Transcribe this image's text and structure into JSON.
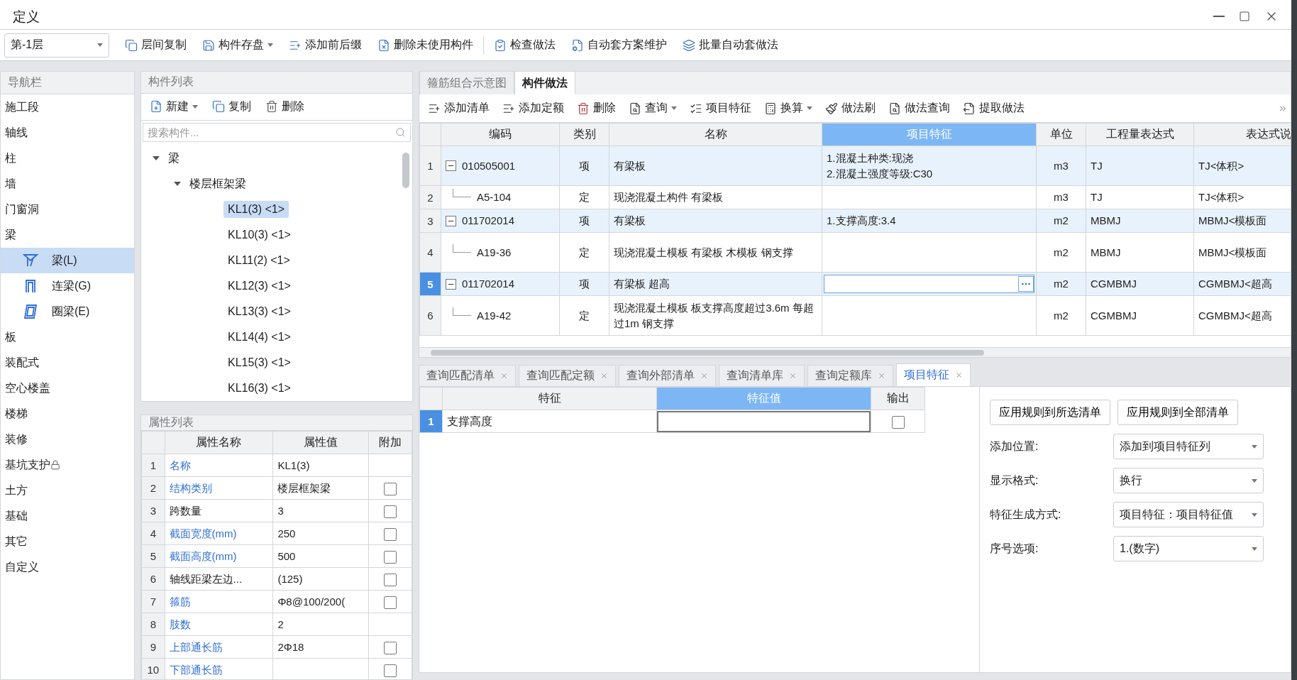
{
  "window": {
    "title": "定义"
  },
  "toolbar": {
    "floor": "第-1层",
    "buttons": [
      {
        "label": "层间复制",
        "dropdown": false
      },
      {
        "label": "构件存盘",
        "dropdown": true
      },
      {
        "label": "添加前后缀",
        "dropdown": false
      },
      {
        "label": "删除未使用构件",
        "dropdown": false
      },
      {
        "label": "检查做法",
        "dropdown": false
      },
      {
        "label": "自动套方案维护",
        "dropdown": false
      },
      {
        "label": "批量自动套做法",
        "dropdown": false
      }
    ]
  },
  "nav": {
    "title": "导航栏",
    "items": [
      {
        "label": "施工段",
        "selected": false
      },
      {
        "label": "轴线",
        "selected": false
      },
      {
        "label": "柱",
        "selected": false
      },
      {
        "label": "墙",
        "selected": false
      },
      {
        "label": "门窗洞",
        "selected": false
      },
      {
        "label": "梁",
        "selected": false,
        "children": [
          {
            "label": "梁(L)",
            "selected": true
          },
          {
            "label": "连梁(G)",
            "selected": false
          },
          {
            "label": "圈梁(E)",
            "selected": false
          }
        ]
      },
      {
        "label": "板",
        "selected": false
      },
      {
        "label": "装配式",
        "selected": false
      },
      {
        "label": "空心楼盖",
        "selected": false
      },
      {
        "label": "楼梯",
        "selected": false
      },
      {
        "label": "装修",
        "selected": false
      },
      {
        "label": "基坑支护",
        "selected": false,
        "locked": true
      },
      {
        "label": "土方",
        "selected": false
      },
      {
        "label": "基础",
        "selected": false
      },
      {
        "label": "其它",
        "selected": false
      },
      {
        "label": "自定义",
        "selected": false
      }
    ]
  },
  "component_list": {
    "title": "构件列表",
    "buttons": [
      {
        "label": "新建",
        "dropdown": true
      },
      {
        "label": "复制",
        "dropdown": false
      },
      {
        "label": "删除",
        "dropdown": false
      }
    ],
    "search": {
      "placeholder": "搜索构件..."
    },
    "tree": [
      {
        "label": "梁",
        "expanded": true,
        "children": [
          {
            "label": "楼层框架梁",
            "expanded": true,
            "children": [
              {
                "label": "KL1(3) <1>",
                "selected": true
              },
              {
                "label": "KL10(3) <1>",
                "selected": false
              },
              {
                "label": "KL11(2) <1>",
                "selected": false
              },
              {
                "label": "KL12(3) <1>",
                "selected": false
              },
              {
                "label": "KL13(3) <1>",
                "selected": false
              },
              {
                "label": "KL14(4) <1>",
                "selected": false
              },
              {
                "label": "KL15(3) <1>",
                "selected": false
              },
              {
                "label": "KL16(3) <1>",
                "selected": false
              }
            ]
          }
        ]
      }
    ]
  },
  "properties": {
    "title": "属性列表",
    "columns": [
      "属性名称",
      "属性值",
      "附加"
    ],
    "rows": [
      {
        "no": "1",
        "name": "名称",
        "value": "KL1(3)",
        "link": true,
        "kind": "plain"
      },
      {
        "no": "2",
        "name": "结构类别",
        "value": "楼层框架梁",
        "link": true,
        "kind": "checkbox",
        "checked": false
      },
      {
        "no": "3",
        "name": "跨数量",
        "value": "3",
        "link": false,
        "kind": "checkbox",
        "checked": false
      },
      {
        "no": "4",
        "name": "截面宽度(mm)",
        "value": "250",
        "link": true,
        "kind": "checkbox",
        "checked": false
      },
      {
        "no": "5",
        "name": "截面高度(mm)",
        "value": "500",
        "link": true,
        "kind": "checkbox",
        "checked": false
      },
      {
        "no": "6",
        "name": "轴线距梁左边...",
        "value": "(125)",
        "link": false,
        "kind": "checkbox",
        "checked": false
      },
      {
        "no": "7",
        "name": "箍筋",
        "value": "Φ8@100/200(",
        "link": true,
        "kind": "checkbox",
        "checked": false
      },
      {
        "no": "8",
        "name": "肢数",
        "value": "2",
        "link": true,
        "kind": "plain"
      },
      {
        "no": "9",
        "name": "上部通长筋",
        "value": "2Φ18",
        "link": true,
        "kind": "checkbox",
        "checked": false
      },
      {
        "no": "10",
        "name": "下部通长筋",
        "link": true,
        "kind": "checkbox",
        "checked": false
      }
    ]
  },
  "method_tabs": [
    {
      "label": "箍筋组合示意图",
      "selected": false
    },
    {
      "label": "构件做法",
      "selected": true
    }
  ],
  "method_toolbar": [
    {
      "label": "添加清单",
      "dropdown": false
    },
    {
      "label": "添加定额",
      "dropdown": false
    },
    {
      "label": "删除",
      "dropdown": false
    },
    {
      "label": "查询",
      "dropdown": true
    },
    {
      "label": "项目特征",
      "dropdown": false
    },
    {
      "label": "换算",
      "dropdown": true
    },
    {
      "label": "做法刷",
      "dropdown": false
    },
    {
      "label": "做法查询",
      "dropdown": false
    },
    {
      "label": "提取做法",
      "dropdown": false
    }
  ],
  "methods_table": {
    "columns": [
      {
        "label": "编码",
        "selected": false
      },
      {
        "label": "类别",
        "selected": false
      },
      {
        "label": "名称",
        "selected": false
      },
      {
        "label": "项目特征",
        "selected": true
      },
      {
        "label": "单位",
        "selected": false
      },
      {
        "label": "工程量表达式",
        "selected": false
      },
      {
        "label": "表达式说",
        "selected": false
      }
    ],
    "rows": [
      {
        "no": "1",
        "kind": "item",
        "selected": false,
        "editing": false,
        "code": "010505001",
        "category": "项",
        "name": "有梁板",
        "feature": [
          "1.混凝土种类:现浇",
          "2.混凝土强度等级:C30"
        ],
        "unit": "m3",
        "expr": "TJ",
        "expr_desc": "TJ<体积>"
      },
      {
        "no": "2",
        "kind": "quota",
        "selected": false,
        "editing": false,
        "code": "A5-104",
        "category": "定",
        "name": "现浇混凝土构件 有梁板",
        "feature": [],
        "unit": "m3",
        "expr": "TJ",
        "expr_desc": "TJ<体积>"
      },
      {
        "no": "3",
        "kind": "item",
        "selected": false,
        "editing": false,
        "code": "011702014",
        "category": "项",
        "name": "有梁板",
        "feature": [
          "1.支撑高度:3.4"
        ],
        "unit": "m2",
        "expr": "MBMJ",
        "expr_desc": "MBMJ<模板面"
      },
      {
        "no": "4",
        "kind": "quota",
        "selected": false,
        "editing": false,
        "code": "A19-36",
        "category": "定",
        "name": "现浇混凝土模板 有梁板 木模板 钢支撑",
        "feature": [],
        "unit": "m2",
        "expr": "MBMJ",
        "expr_desc": "MBMJ<模板面"
      },
      {
        "no": "5",
        "kind": "item",
        "selected": true,
        "editing": true,
        "code": "011702014",
        "category": "项",
        "name": "有梁板 超高",
        "feature": [],
        "unit": "m2",
        "expr": "CGMBMJ",
        "expr_desc": "CGMBMJ<超高"
      },
      {
        "no": "6",
        "kind": "quota",
        "selected": false,
        "editing": false,
        "code": "A19-42",
        "category": "定",
        "name": "现浇混凝土模板 板支撑高度超过3.6m 每超过1m 钢支撑",
        "feature": [],
        "unit": "m2",
        "expr": "CGMBMJ",
        "expr_desc": "CGMBMJ<超高"
      }
    ]
  },
  "bottom_tabs": [
    {
      "label": "查询匹配清单",
      "selected": false
    },
    {
      "label": "查询匹配定额",
      "selected": false
    },
    {
      "label": "查询外部清单",
      "selected": false
    },
    {
      "label": "查询清单库",
      "selected": false
    },
    {
      "label": "查询定额库",
      "selected": false
    },
    {
      "label": "项目特征",
      "selected": true
    }
  ],
  "feature_table": {
    "columns": [
      {
        "label": "特征",
        "selected": false
      },
      {
        "label": "特征值",
        "selected": true
      },
      {
        "label": "输出",
        "selected": false
      }
    ],
    "rows": [
      {
        "no": "1",
        "selected": true,
        "feature": "支撑高度",
        "output": false
      }
    ]
  },
  "rule_panel": {
    "buttons": [
      "应用规则到所选清单",
      "应用规则到全部清单"
    ],
    "settings": [
      {
        "label": "添加位置:",
        "value": "添加到项目特征列"
      },
      {
        "label": "显示格式:",
        "value": "换行"
      },
      {
        "label": "特征生成方式:",
        "value": "项目特征：项目特征值"
      },
      {
        "label": "序号选项:",
        "value": "1.(数字)"
      }
    ]
  }
}
